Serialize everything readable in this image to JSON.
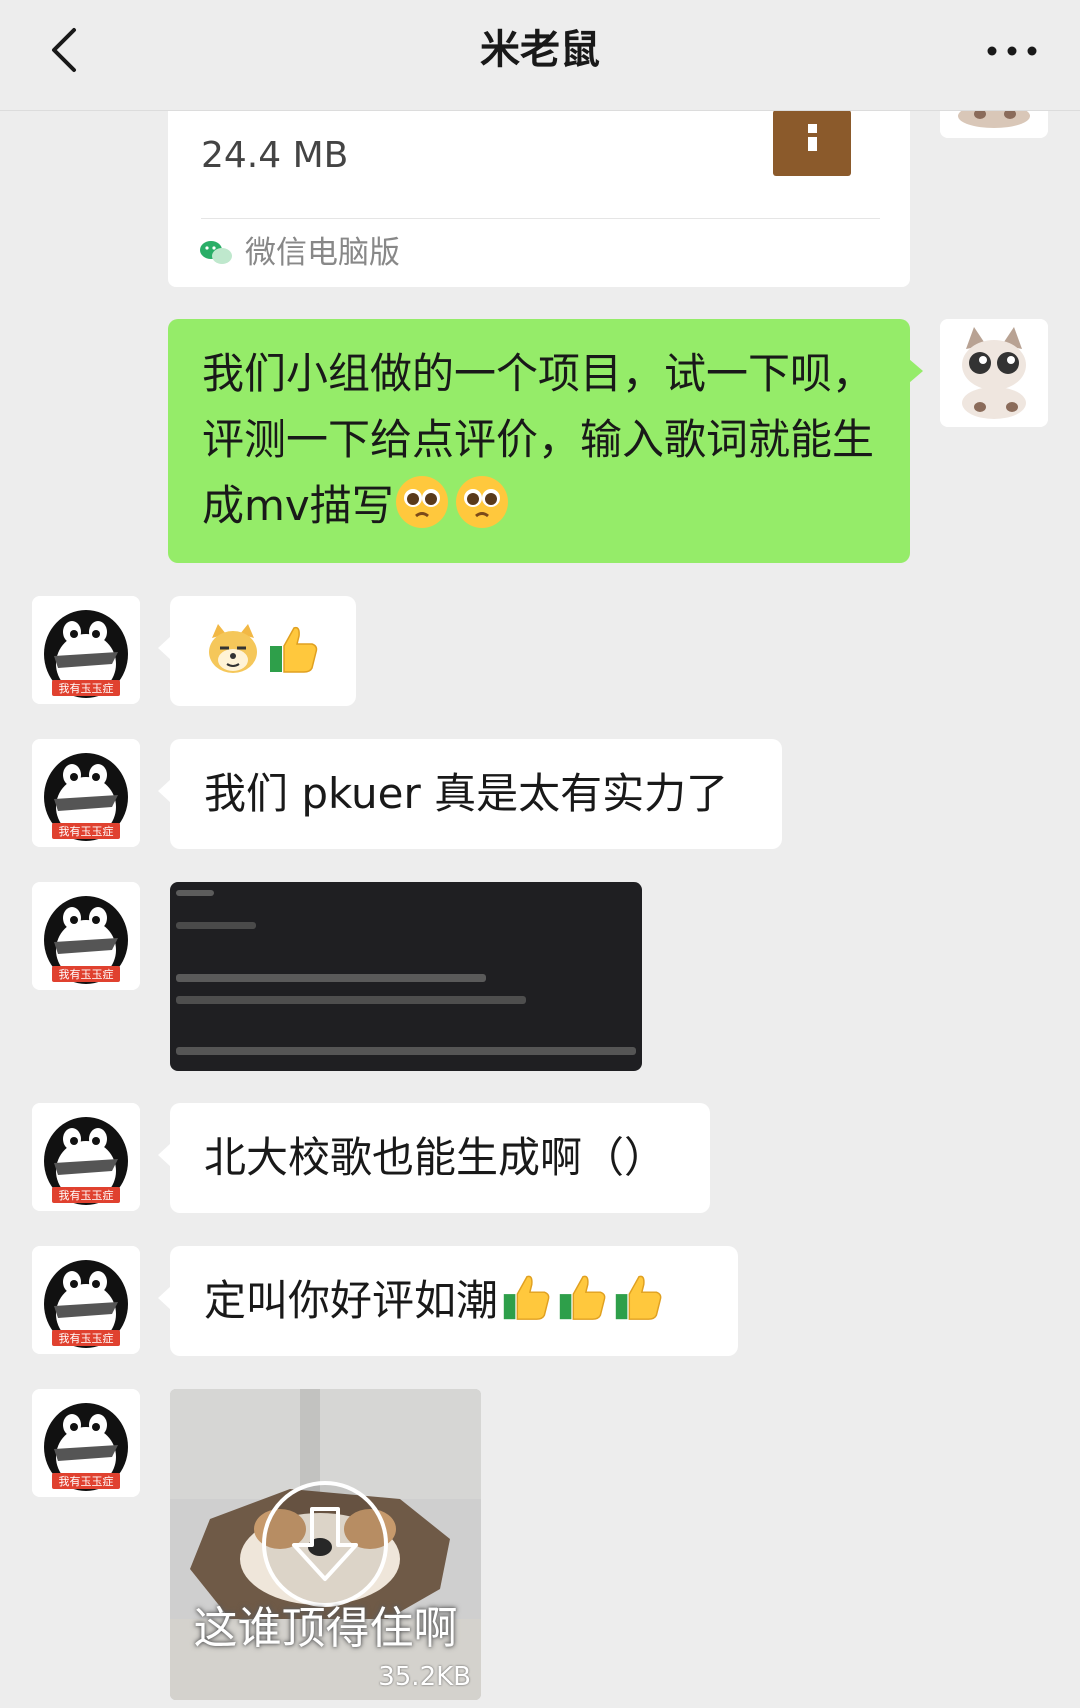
{
  "header": {
    "title": "米老鼠"
  },
  "file_card": {
    "size": "24.4 MB",
    "source": "微信电脑版"
  },
  "messages": {
    "m1": {
      "text": "我们小组做的一个项目，试一下呗，评测一下给点评价，输入歌词就能生成mv描写"
    },
    "m3": {
      "text": "我们 pkuer 真是太有实力了"
    },
    "m5": {
      "text": "北大校歌也能生成啊（）"
    },
    "m6": {
      "text": "定叫你好评如潮"
    },
    "m7": {
      "caption": "这谁顶得住啊",
      "size": "35.2KB"
    }
  },
  "avatar": {
    "badge": "我有玉玉症"
  },
  "colors": {
    "background": "#ededed",
    "self_bubble": "#95ec69",
    "other_bubble": "#ffffff",
    "file_icon": "#8b5a2b"
  },
  "icons": [
    "back-icon",
    "more-icon",
    "file-icon",
    "wechat-icon",
    "pleading-face-icon",
    "doge-icon",
    "thumbs-up-icon",
    "download-icon"
  ]
}
